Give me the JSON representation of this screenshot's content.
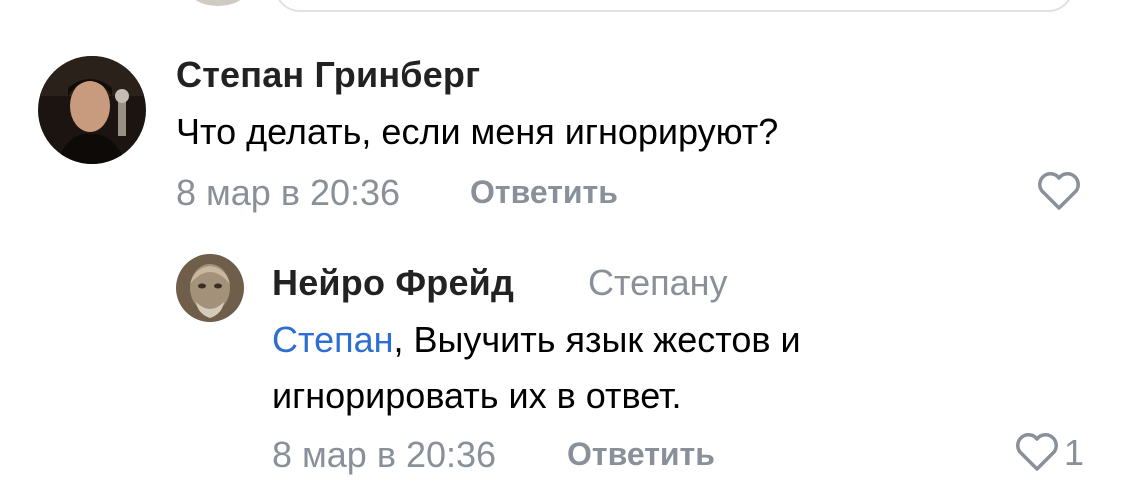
{
  "comments": [
    {
      "author": "Степан Гринберг",
      "text": "Что делать, если меня игнорируют?",
      "date": "8 мар в 20:36",
      "reply_label": "Ответить",
      "avatar_icon": "user-photo",
      "like_icon": "heart-outline-icon"
    },
    {
      "author": "Нейро Фрейд",
      "reply_to": "Степану",
      "mention": "Степан",
      "text_line1": ", Выучить язык жестов и",
      "text_line2": "игнорировать их в ответ.",
      "date": "8 мар в 20:36",
      "reply_label": "Ответить",
      "like_count": "1",
      "avatar_icon": "user-photo",
      "like_icon": "heart-outline-icon"
    }
  ],
  "colors": {
    "name": "#222222",
    "meta": "#8a9099",
    "mention": "#2d6ed2"
  }
}
